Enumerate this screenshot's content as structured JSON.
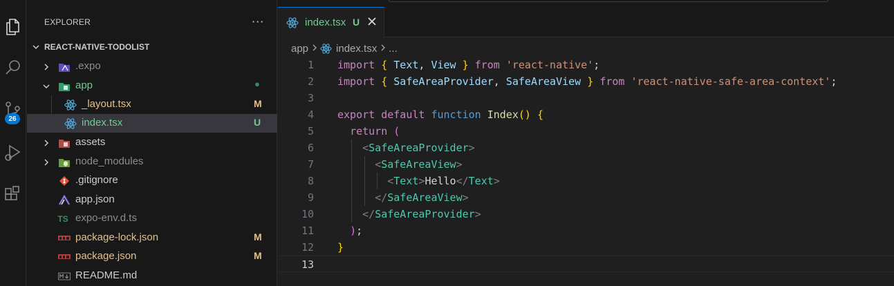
{
  "activity_bar": {
    "icons": [
      "explorer-icon",
      "search-icon",
      "source-control-icon",
      "run-debug-icon",
      "extensions-icon"
    ],
    "source_control_badge": "26"
  },
  "sidebar": {
    "title": "EXPLORER",
    "more_actions": "···",
    "project": "REACT-NATIVE-TODOLIST",
    "items": [
      {
        "label": ".expo",
        "type": "folder",
        "expanded": false,
        "status": "",
        "icon": "expo-folder-icon",
        "color": "#8c8c8c"
      },
      {
        "label": "app",
        "type": "folder",
        "expanded": true,
        "status": "●",
        "icon": "app-folder-icon",
        "color": "#73c991"
      },
      {
        "label": "_layout.tsx",
        "type": "file",
        "status": "M",
        "icon": "react-icon",
        "color": "#e2c08d"
      },
      {
        "label": "index.tsx",
        "type": "file",
        "status": "U",
        "icon": "react-icon",
        "color": "#73c991",
        "selected": true
      },
      {
        "label": "assets",
        "type": "folder",
        "expanded": false,
        "status": "",
        "icon": "assets-folder-icon",
        "color": "#cccccc"
      },
      {
        "label": "node_modules",
        "type": "folder",
        "expanded": false,
        "status": "",
        "icon": "node-folder-icon",
        "color": "#8c8c8c"
      },
      {
        "label": ".gitignore",
        "type": "file",
        "status": "",
        "icon": "git-icon",
        "color": "#cccccc"
      },
      {
        "label": "app.json",
        "type": "file",
        "status": "",
        "icon": "expo-icon",
        "color": "#cccccc"
      },
      {
        "label": "expo-env.d.ts",
        "type": "file",
        "status": "",
        "icon": "ts-icon",
        "color": "#8c8c8c"
      },
      {
        "label": "package-lock.json",
        "type": "file",
        "status": "M",
        "icon": "npm-icon",
        "color": "#e2c08d"
      },
      {
        "label": "package.json",
        "type": "file",
        "status": "M",
        "icon": "npm-icon",
        "color": "#e2c08d"
      },
      {
        "label": "README.md",
        "type": "file",
        "status": "",
        "icon": "markdown-icon",
        "color": "#cccccc"
      }
    ]
  },
  "editor": {
    "tab": {
      "label": "index.tsx",
      "status": "U"
    },
    "breadcrumb": {
      "folder": "app",
      "file": "index.tsx",
      "more": "..."
    },
    "current_line": 13,
    "lines": [
      {
        "n": "1",
        "tokens": [
          [
            "kw",
            "import"
          ],
          [
            "plain",
            " "
          ],
          [
            "br1",
            "{"
          ],
          [
            "plain",
            " "
          ],
          [
            "var",
            "Text"
          ],
          [
            "plain",
            ", "
          ],
          [
            "var",
            "View"
          ],
          [
            "plain",
            " "
          ],
          [
            "br1",
            "}"
          ],
          [
            "plain",
            " "
          ],
          [
            "kw",
            "from"
          ],
          [
            "plain",
            " "
          ],
          [
            "str",
            "'react-native'"
          ],
          [
            "plain",
            ";"
          ]
        ]
      },
      {
        "n": "2",
        "tokens": [
          [
            "kw",
            "import"
          ],
          [
            "plain",
            " "
          ],
          [
            "br1",
            "{"
          ],
          [
            "plain",
            " "
          ],
          [
            "var",
            "SafeAreaProvider"
          ],
          [
            "plain",
            ", "
          ],
          [
            "var",
            "SafeAreaView"
          ],
          [
            "plain",
            " "
          ],
          [
            "br1",
            "}"
          ],
          [
            "plain",
            " "
          ],
          [
            "kw",
            "from"
          ],
          [
            "plain",
            " "
          ],
          [
            "str",
            "'react-native-safe-area-context'"
          ],
          [
            "plain",
            ";"
          ]
        ]
      },
      {
        "n": "3",
        "tokens": []
      },
      {
        "n": "4",
        "tokens": [
          [
            "kw",
            "export"
          ],
          [
            "plain",
            " "
          ],
          [
            "kw",
            "default"
          ],
          [
            "plain",
            " "
          ],
          [
            "kb",
            "function"
          ],
          [
            "plain",
            " "
          ],
          [
            "fn",
            "Index"
          ],
          [
            "br1",
            "()"
          ],
          [
            "plain",
            " "
          ],
          [
            "br1",
            "{"
          ]
        ]
      },
      {
        "n": "5",
        "tokens": [
          [
            "plain",
            "  "
          ],
          [
            "kw",
            "return"
          ],
          [
            "plain",
            " "
          ],
          [
            "br2",
            "("
          ]
        ]
      },
      {
        "n": "6",
        "tokens": [
          [
            "plain",
            "    "
          ],
          [
            "punct",
            "<"
          ],
          [
            "tag",
            "SafeAreaProvider"
          ],
          [
            "punct",
            ">"
          ]
        ]
      },
      {
        "n": "7",
        "tokens": [
          [
            "plain",
            "      "
          ],
          [
            "punct",
            "<"
          ],
          [
            "tag",
            "SafeAreaView"
          ],
          [
            "punct",
            ">"
          ]
        ]
      },
      {
        "n": "8",
        "tokens": [
          [
            "plain",
            "        "
          ],
          [
            "punct",
            "<"
          ],
          [
            "tag",
            "Text"
          ],
          [
            "punct",
            ">"
          ],
          [
            "plain",
            "Hello"
          ],
          [
            "punct",
            "</"
          ],
          [
            "tag",
            "Text"
          ],
          [
            "punct",
            ">"
          ]
        ]
      },
      {
        "n": "9",
        "tokens": [
          [
            "plain",
            "      "
          ],
          [
            "punct",
            "</"
          ],
          [
            "tag",
            "SafeAreaView"
          ],
          [
            "punct",
            ">"
          ]
        ]
      },
      {
        "n": "10",
        "tokens": [
          [
            "plain",
            "    "
          ],
          [
            "punct",
            "</"
          ],
          [
            "tag",
            "SafeAreaProvider"
          ],
          [
            "punct",
            ">"
          ]
        ]
      },
      {
        "n": "11",
        "tokens": [
          [
            "plain",
            "  "
          ],
          [
            "br2",
            ")"
          ],
          [
            "plain",
            ";"
          ]
        ]
      },
      {
        "n": "12",
        "tokens": [
          [
            "br1",
            "}"
          ]
        ]
      },
      {
        "n": "13",
        "tokens": []
      }
    ]
  },
  "colors": {
    "accent": "#0078d4",
    "untracked": "#73c991",
    "modified": "#e2c08d"
  }
}
